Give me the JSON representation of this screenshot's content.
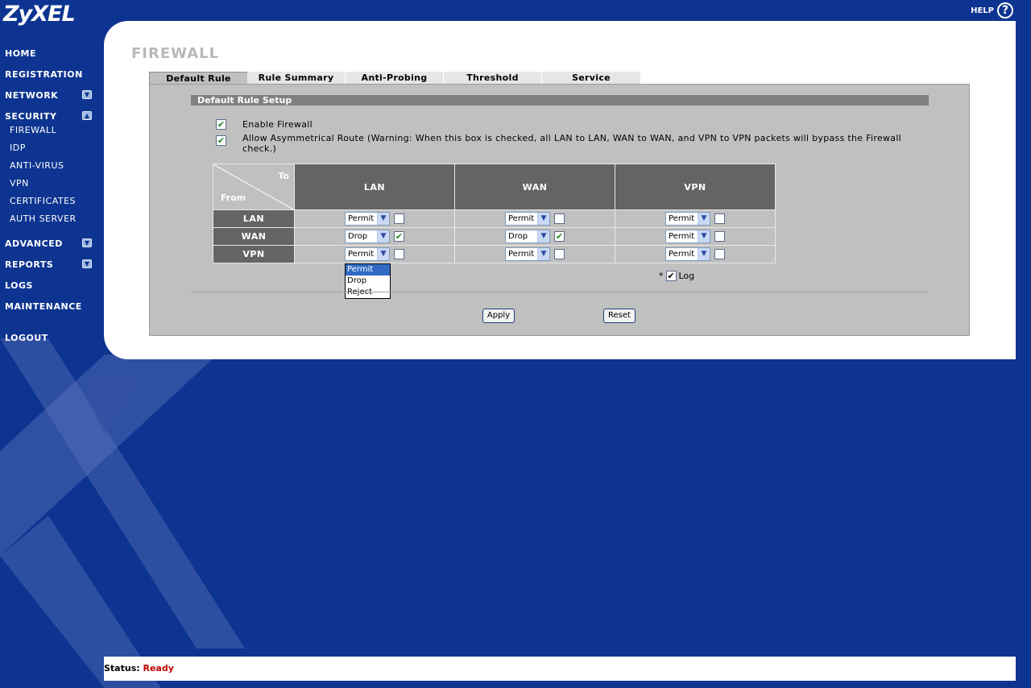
{
  "brand": {
    "logo": "ZyXEL",
    "help_label": "HELP",
    "help_glyph": "?"
  },
  "nav": {
    "items": [
      {
        "label": "HOME"
      },
      {
        "label": "REGISTRATION"
      },
      {
        "label": "NETWORK",
        "toggle": "expand"
      },
      {
        "label": "SECURITY",
        "toggle": "collapse"
      },
      {
        "label": "ADVANCED",
        "toggle": "expand"
      },
      {
        "label": "REPORTS",
        "toggle": "expand"
      },
      {
        "label": "LOGS"
      },
      {
        "label": "MAINTENANCE"
      },
      {
        "label": "LOGOUT"
      }
    ],
    "security_sub": [
      "FIREWALL",
      "IDP",
      "ANTI-VIRUS",
      "VPN",
      "CERTIFICATES",
      "AUTH SERVER"
    ]
  },
  "page": {
    "title": "FIREWALL"
  },
  "tabs": [
    "Default Rule",
    "Rule Summary",
    "Anti-Probing",
    "Threshold",
    "Service"
  ],
  "active_tab": "Default Rule",
  "section": {
    "title": "Default Rule Setup"
  },
  "options": {
    "enable_firewall": {
      "label": "Enable Firewall",
      "checked": true
    },
    "asym_route": {
      "label_line1": "Allow Asymmetrical Route (Warning: When this box is checked, all LAN to LAN, WAN to WAN, and VPN to VPN packets will bypass the Firewall",
      "label_line2": "check.)",
      "checked": true
    }
  },
  "matrix": {
    "corner_to": "To",
    "corner_from": "From",
    "columns": [
      "LAN",
      "WAN",
      "VPN"
    ],
    "rows": [
      {
        "label": "LAN",
        "cells": [
          {
            "action": "Permit",
            "log": false
          },
          {
            "action": "Permit",
            "log": false
          },
          {
            "action": "Permit",
            "log": false
          }
        ]
      },
      {
        "label": "WAN",
        "cells": [
          {
            "action": "Drop",
            "log": true
          },
          {
            "action": "Drop",
            "log": true
          },
          {
            "action": "Permit",
            "log": false
          }
        ]
      },
      {
        "label": "VPN",
        "cells": [
          {
            "action": "Permit",
            "log": false
          },
          {
            "action": "Permit",
            "log": false
          },
          {
            "action": "Permit",
            "log": false
          }
        ]
      }
    ]
  },
  "dropdown_open": {
    "options": [
      "Permit",
      "Drop",
      "Reject"
    ],
    "highlighted": "Permit"
  },
  "log_legend": {
    "star": "*",
    "label": "Log",
    "checked": true
  },
  "buttons": {
    "apply": "Apply",
    "reset": "Reset"
  },
  "status": {
    "label": "Status:",
    "value": "Ready"
  }
}
